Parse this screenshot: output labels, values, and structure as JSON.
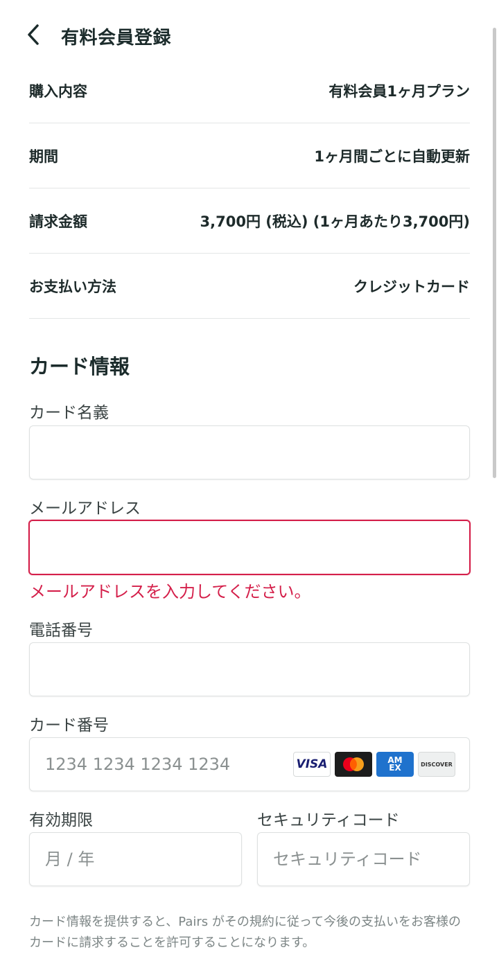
{
  "header": {
    "title": "有料会員登録",
    "back_icon": "chevron-left-icon"
  },
  "summary": [
    {
      "label": "購入内容",
      "value": "有料会員1ヶ月プラン"
    },
    {
      "label": "期間",
      "value": "1ヶ月間ごとに自動更新"
    },
    {
      "label": "請求金額",
      "value": "3,700円 (税込) (1ヶ月あたり3,700円)"
    },
    {
      "label": "お支払い方法",
      "value": "クレジットカード"
    }
  ],
  "card_section": {
    "title": "カード情報",
    "name_label": "カード名義",
    "name_value": "",
    "email_label": "メールアドレス",
    "email_value": "",
    "email_error": "メールアドレスを入力してください。",
    "phone_label": "電話番号",
    "phone_value": "",
    "number_label": "カード番号",
    "number_placeholder": "1234 1234 1234 1234",
    "expiry_label": "有効期限",
    "expiry_placeholder": "月 / 年",
    "cvc_label": "セキュリティコード",
    "cvc_placeholder": "セキュリティコード",
    "logos": {
      "visa": "VISA",
      "amex_top": "AM",
      "amex_bottom": "EX",
      "discover": "DISCOVER"
    }
  },
  "disclaimer": "カード情報を提供すると、Pairs がその規約に従って今後の支払いをお客様のカードに請求することを許可することになります。",
  "colors": {
    "error": "#d41f4a",
    "text": "#1d2a2a",
    "border": "#dde0e0"
  }
}
